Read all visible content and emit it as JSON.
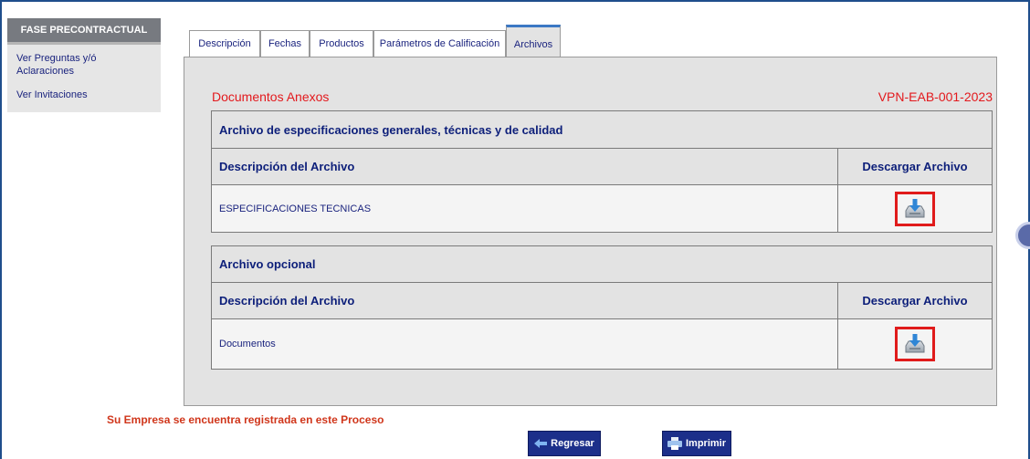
{
  "sidebar": {
    "header": "FASE PRECONTRACTUAL",
    "items": [
      {
        "label_line1": "Ver Preguntas y/ó",
        "label_line2": "Aclaraciones"
      },
      {
        "label_line1": "Ver Invitaciones"
      }
    ]
  },
  "tabs": [
    {
      "label": "Descripción",
      "active": false
    },
    {
      "label": "Fechas",
      "active": false
    },
    {
      "label": "Productos",
      "active": false
    },
    {
      "label": "Parámetros de Calificación",
      "active": false
    },
    {
      "label": "Archivos",
      "active": true
    }
  ],
  "main": {
    "title": "Documentos Anexos",
    "process_code": "VPN-EAB-001-2023",
    "sections": [
      {
        "title": "Archivo de especificaciones generales, técnicas y de calidad",
        "col_description": "Descripción del Archivo",
        "col_download": "Descargar Archivo",
        "files": [
          {
            "name": "ESPECIFICACIONES TECNICAS"
          }
        ]
      },
      {
        "title": "Archivo opcional",
        "col_description": "Descripción del Archivo",
        "col_download": "Descargar Archivo",
        "files": [
          {
            "name": "Documentos"
          }
        ]
      }
    ]
  },
  "footer": {
    "registered_message": "Su Empresa se encuentra registrada en este Proceso",
    "back_label": "Regresar",
    "print_label": "Imprimir"
  },
  "colors": {
    "accent_red": "#e3191d",
    "navy": "#1c2f8a",
    "highlight_border": "#e01b1b"
  }
}
